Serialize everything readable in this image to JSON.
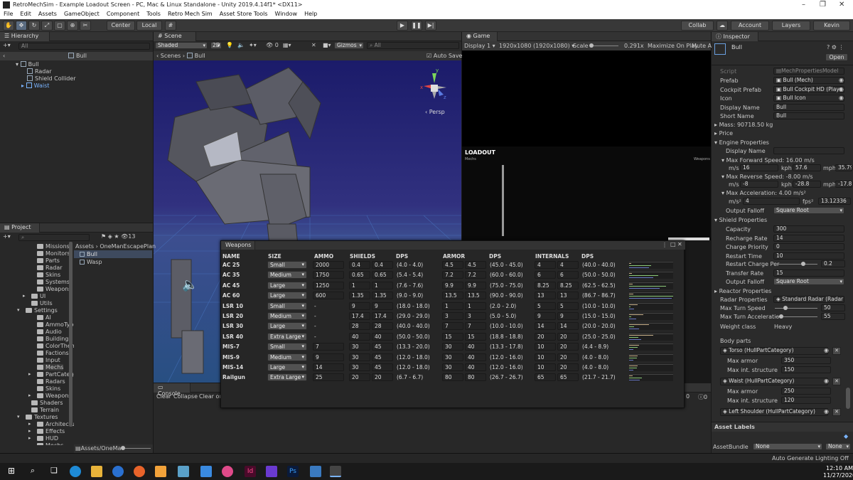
{
  "window": {
    "title": "RetroMechSim - Example Loadout Screen - PC, Mac & Linux Standalone - Unity 2019.4.14f1* <DX11>"
  },
  "menu": [
    "File",
    "Edit",
    "Assets",
    "GameObject",
    "Component",
    "Tools",
    "Retro Mech Sim",
    "Asset Store Tools",
    "Window",
    "Help"
  ],
  "toolbar": {
    "center": "Center",
    "local": "Local",
    "collab": "Collab",
    "account": "Account",
    "layers": "Layers",
    "layout": "Kevin"
  },
  "hierarchy": {
    "tab": "Hierarchy",
    "search_placeholder": "All",
    "scene": "Bull",
    "items": [
      {
        "label": "Bull"
      },
      {
        "label": "Radar"
      },
      {
        "label": "Shield Collider"
      },
      {
        "label": "Waist"
      }
    ]
  },
  "scene": {
    "tab": "Scene",
    "shading": "Shaded",
    "mode2d": "2D",
    "gizmos": "Gizmos",
    "search_placeholder": "All",
    "breadcrumb_root": "Scenes",
    "breadcrumb_obj": "Bull",
    "auto_save": "Auto Save",
    "persp": "Persp",
    "hidden_count": "0"
  },
  "game": {
    "tab": "Game",
    "display": "Display 1",
    "resolution": "1920x1080 (1920x1080)",
    "scale_label": "Scale",
    "scale_value": "0.291x",
    "maximize": "Maximize On Play",
    "mute": "Mute Audio",
    "stats": "St",
    "loadout_title": "LOADOUT",
    "loadout_sub": "Mechs",
    "weapons_label": "Weapons"
  },
  "project": {
    "tab": "Project",
    "count": "13",
    "breadcrumb": [
      "Assets",
      "OneManEscapePlan"
    ],
    "bottom_path": "Assets/OneMa",
    "tree": [
      "Missions",
      "Monitors",
      "Parts",
      "Radar",
      "Skins",
      "Systems",
      "Weapons",
      "UI",
      "Utils",
      "Settings",
      "AI",
      "AmmoTypes",
      "Audio",
      "Buildings",
      "ColorThemes",
      "Factions",
      "Input",
      "Mechs",
      "PartCategory",
      "Radars",
      "Skins",
      "Weapons",
      "Shaders",
      "Terrain",
      "Textures",
      "Architecture",
      "Effects",
      "HUD",
      "Mechs",
      "Terrain"
    ],
    "files": [
      "Bull",
      "Wasp"
    ]
  },
  "console": {
    "tab": "Console",
    "clear": "Clear",
    "collapse": "Collapse",
    "clear_on": "Clear on",
    "warn_count": "0",
    "err_count": "0"
  },
  "weapons": {
    "title": "Weapons",
    "headers": [
      "NAME",
      "SIZE",
      "AMMO",
      "SHIELDS",
      "DPS",
      "ARMOR",
      "DPS",
      "INTERNALS",
      "DPS"
    ],
    "rows": [
      {
        "name": "AC 25",
        "size": "Small",
        "ammo": "2000",
        "sh1": "0.4",
        "sh2": "0.4",
        "sdps": "(4.0 - 4.0)",
        "ar1": "4.5",
        "ar2": "4.5",
        "adps": "(45.0 - 45.0)",
        "in1": "4",
        "in2": "4",
        "idps": "(40.0 - 40.0)"
      },
      {
        "name": "AC 35",
        "size": "Medium",
        "ammo": "1750",
        "sh1": "0.65",
        "sh2": "0.65",
        "sdps": "(5.4 - 5.4)",
        "ar1": "7.2",
        "ar2": "7.2",
        "adps": "(60.0 - 60.0)",
        "in1": "6",
        "in2": "6",
        "idps": "(50.0 - 50.0)"
      },
      {
        "name": "AC 45",
        "size": "Large",
        "ammo": "1250",
        "sh1": "1",
        "sh2": "1",
        "sdps": "(7.6 - 7.6)",
        "ar1": "9.9",
        "ar2": "9.9",
        "adps": "(75.0 - 75.0)",
        "in1": "8.25",
        "in2": "8.25",
        "idps": "(62.5 - 62.5)"
      },
      {
        "name": "AC 60",
        "size": "Large",
        "ammo": "600",
        "sh1": "1.35",
        "sh2": "1.35",
        "sdps": "(9.0 - 9.0)",
        "ar1": "13.5",
        "ar2": "13.5",
        "adps": "(90.0 - 90.0)",
        "in1": "13",
        "in2": "13",
        "idps": "(86.7 - 86.7)"
      },
      {
        "name": "LSR 10",
        "size": "Small",
        "ammo": "-",
        "sh1": "9",
        "sh2": "9",
        "sdps": "(18.0 - 18.0)",
        "ar1": "1",
        "ar2": "1",
        "adps": "(2.0 - 2.0)",
        "in1": "5",
        "in2": "5",
        "idps": "(10.0 - 10.0)"
      },
      {
        "name": "LSR 20",
        "size": "Medium",
        "ammo": "-",
        "sh1": "17.4",
        "sh2": "17.4",
        "sdps": "(29.0 - 29.0)",
        "ar1": "3",
        "ar2": "3",
        "adps": "(5.0 - 5.0)",
        "in1": "9",
        "in2": "9",
        "idps": "(15.0 - 15.0)"
      },
      {
        "name": "LSR 30",
        "size": "Large",
        "ammo": "-",
        "sh1": "28",
        "sh2": "28",
        "sdps": "(40.0 - 40.0)",
        "ar1": "7",
        "ar2": "7",
        "adps": "(10.0 - 10.0)",
        "in1": "14",
        "in2": "14",
        "idps": "(20.0 - 20.0)"
      },
      {
        "name": "LSR 40",
        "size": "Extra Large",
        "ammo": "-",
        "sh1": "40",
        "sh2": "40",
        "sdps": "(50.0 - 50.0)",
        "ar1": "15",
        "ar2": "15",
        "adps": "(18.8 - 18.8)",
        "in1": "20",
        "in2": "20",
        "idps": "(25.0 - 25.0)"
      },
      {
        "name": "MIS-7",
        "size": "Small",
        "ammo": "7",
        "sh1": "30",
        "sh2": "45",
        "sdps": "(13.3 - 20.0)",
        "ar1": "30",
        "ar2": "40",
        "adps": "(13.3 - 17.8)",
        "in1": "10",
        "in2": "20",
        "idps": "(4.4 - 8.9)"
      },
      {
        "name": "MIS-9",
        "size": "Medium",
        "ammo": "9",
        "sh1": "30",
        "sh2": "45",
        "sdps": "(12.0 - 18.0)",
        "ar1": "30",
        "ar2": "40",
        "adps": "(12.0 - 16.0)",
        "in1": "10",
        "in2": "20",
        "idps": "(4.0 - 8.0)"
      },
      {
        "name": "MIS-14",
        "size": "Large",
        "ammo": "14",
        "sh1": "30",
        "sh2": "45",
        "sdps": "(12.0 - 18.0)",
        "ar1": "30",
        "ar2": "40",
        "adps": "(12.0 - 16.0)",
        "in1": "10",
        "in2": "20",
        "idps": "(4.0 - 8.0)"
      },
      {
        "name": "Railgun",
        "size": "Extra Large",
        "ammo": "25",
        "sh1": "20",
        "sh2": "20",
        "sdps": "(6.7 - 6.7)",
        "ar1": "80",
        "ar2": "80",
        "adps": "(26.7 - 26.7)",
        "in1": "65",
        "in2": "65",
        "idps": "(21.7 - 21.7)"
      }
    ]
  },
  "inspector": {
    "tab": "Inspector",
    "object": "Bull",
    "open": "Open",
    "script_label": "Script",
    "script_value": "MechPropertiesModel",
    "props": [
      {
        "label": "Prefab",
        "value": "Bull (Mech)"
      },
      {
        "label": "Cockpit Prefab",
        "value": "Bull Cockpit HD (Playe"
      },
      {
        "label": "Icon",
        "value": "Bull Icon"
      },
      {
        "label": "Display Name",
        "value": "Bull"
      },
      {
        "label": "Short Name",
        "value": "Bull"
      }
    ],
    "mass": "Mass: 90718.50 kg",
    "price": "Price",
    "engine": "Engine Properties",
    "engine_display_name": "Display Name",
    "max_fwd": "Max Forward Speed: 16.00 m/s",
    "fwd_ms": "16",
    "fwd_kph": "57.6",
    "fwd_mph": "35.7910",
    "max_rev": "Max Reverse Speed: -8.00 m/s",
    "rev_ms": "-8",
    "rev_kph": "-28.8",
    "rev_mph": "-17.8955",
    "max_acc": "Max Acceleration: 4.00 m/s²",
    "acc_ms": "4",
    "acc_fps": "13.12336",
    "unit_ms": "m/s",
    "unit_kph": "kph",
    "unit_mph": "mph",
    "unit_ms2": "m/s²",
    "unit_fps2": "fps²",
    "output_falloff": "Output Falloff",
    "falloff_value": "Square Root",
    "shield": "Shield Properties",
    "shield_props": [
      {
        "label": "Capacity",
        "value": "300"
      },
      {
        "label": "Recharge Rate",
        "value": "14"
      },
      {
        "label": "Charge Priority",
        "value": "0"
      },
      {
        "label": "Restart Time",
        "value": "10"
      }
    ],
    "restart_charge_label": "Restart Charge Per",
    "restart_charge_value": "0.2",
    "transfer_label": "Transfer Rate",
    "transfer_value": "15",
    "shield_falloff_value": "Square Root",
    "reactor": "Reactor Properties",
    "radar_label": "Radar Properties",
    "radar_value": "Standard Radar (Radar",
    "turn_speed_label": "Max Turn Speed",
    "turn_speed_value": "50",
    "turn_acc_label": "Max Turn Acceleratio",
    "turn_acc_value": "55",
    "weight_label": "Weight class",
    "weight_value": "Heavy",
    "body_parts": "Body parts",
    "parts": [
      {
        "name": "Torso (HullPartCategory)",
        "armor": "350",
        "internal": "150"
      },
      {
        "name": "Waist (HullPartCategory)",
        "armor": "250",
        "internal": "120"
      },
      {
        "name": "Left Shoulder (HullPartCategory)"
      }
    ],
    "max_armor": "Max armor",
    "max_int": "Max int. structure",
    "asset_labels": "Asset Labels",
    "asset_bundle": "AssetBundle",
    "bundle_value": "None",
    "bundle_variant": "None"
  },
  "status": {
    "lighting": "Auto Generate Lighting Off"
  },
  "taskbar": {
    "time": "12:10 AM",
    "date": "11/27/2020"
  }
}
